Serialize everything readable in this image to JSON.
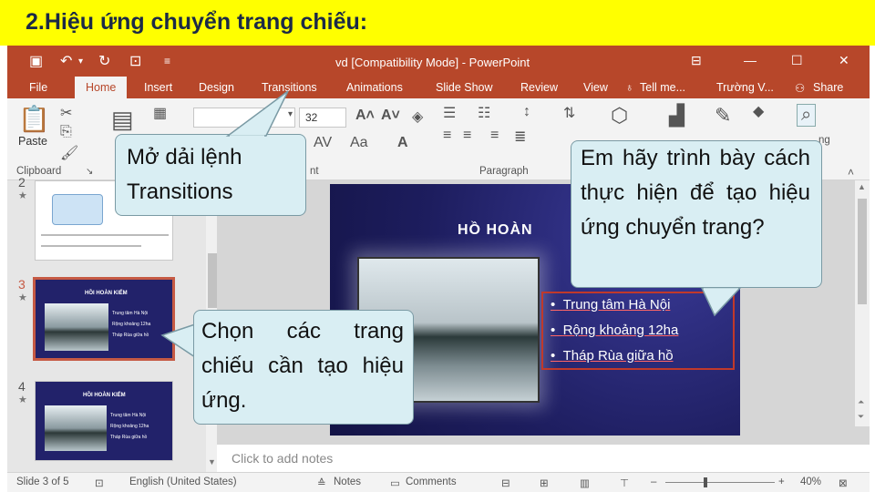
{
  "banner": {
    "text": "2.Hiệu ứng chuyển trang chiếu:"
  },
  "window": {
    "title": "vd [Compatibility Mode] - PowerPoint"
  },
  "tabs": [
    "File",
    "Home",
    "Insert",
    "Design",
    "Transitions",
    "Animations",
    "Slide Show",
    "Review",
    "View",
    "Tell me...",
    "Trường V...",
    "Share"
  ],
  "ribbon": {
    "paste": "Paste",
    "clipboard": "Clipboard",
    "font_size": "32",
    "font_group_tail": "nt",
    "paragraph": "Paragraph",
    "editing_tail": "ng"
  },
  "thumbnails": {
    "items": [
      {
        "num": "2",
        "star": "★"
      },
      {
        "num": "3",
        "star": "★"
      },
      {
        "num": "4",
        "star": "★"
      }
    ],
    "mini_heading": "HỒI HOÀN KIẾM",
    "mini_bullets": [
      "Trung tâm Hà Nội",
      "Rộng khoảng 12ha",
      "Tháp Rùa giữa hồ"
    ]
  },
  "slide": {
    "heading": "HỒ HOÀN",
    "bullets": [
      "Trung tâm Hà Nội",
      "Rộng khoảng 12ha",
      "Tháp Rùa giữa hồ"
    ]
  },
  "notes": {
    "placeholder": "Click to add notes"
  },
  "status": {
    "slide_info": "Slide 3 of 5",
    "language": "English (United States)",
    "notes_btn": "Notes",
    "comments_btn": "Comments",
    "zoom": "40%"
  },
  "callouts": {
    "transitions": "Mở dải lệnh Transitions",
    "choose": "Chọn các trang chiếu cần tạo hiệu ứng.",
    "question": "Em hãy trình bày cách thực hiện để tạo hiệu ứng chuyển trang?"
  },
  "colors": {
    "accent": "#b7472a",
    "banner": "#ffff00",
    "callout_bg": "#d9eef3"
  }
}
